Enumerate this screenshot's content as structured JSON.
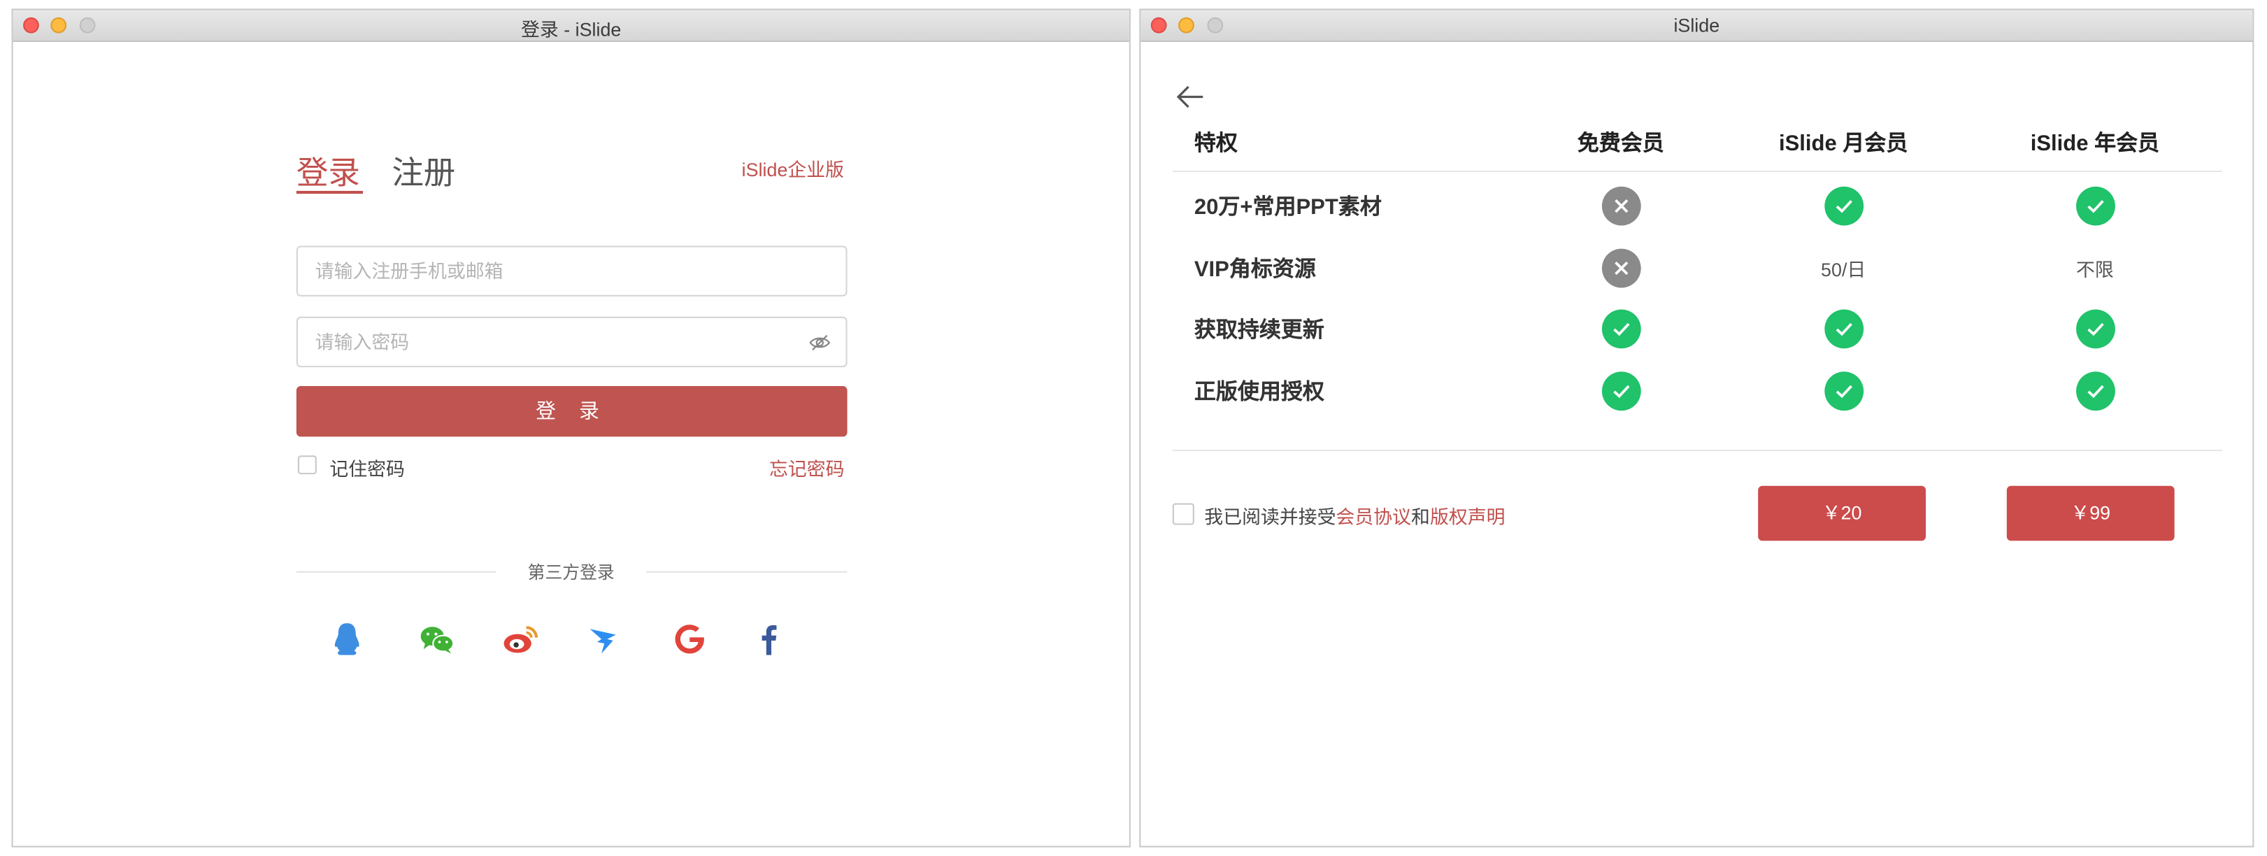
{
  "login_window": {
    "title": "登录 - iSlide",
    "tabs": {
      "login": "登录",
      "register": "注册"
    },
    "enterprise_link": "iSlide企业版",
    "account_input": {
      "placeholder": "请输入注册手机或邮箱",
      "value": ""
    },
    "password_input": {
      "placeholder": "请输入密码",
      "value": ""
    },
    "login_button": "登 录",
    "remember_label": "记住密码",
    "forgot_link": "忘记密码",
    "third_party_label": "第三方登录",
    "social_icons": [
      "qq-icon",
      "wechat-icon",
      "weibo-icon",
      "dingtalk-icon",
      "google-icon",
      "facebook-icon"
    ]
  },
  "membership_window": {
    "title": "iSlide",
    "headers": {
      "feature": "特权",
      "free": "免费会员",
      "monthly": "iSlide 月会员",
      "yearly": "iSlide 年会员"
    },
    "rows": [
      {
        "feature": "20万+常用PPT素材",
        "free": "x-icon",
        "monthly": "check-icon",
        "yearly": "check-icon"
      },
      {
        "feature": "VIP角标资源",
        "free": "x-icon",
        "monthly": "50/日",
        "yearly": "不限"
      },
      {
        "feature": "获取持续更新",
        "free": "check-icon",
        "monthly": "check-icon",
        "yearly": "check-icon"
      },
      {
        "feature": "正版使用授权",
        "free": "check-icon",
        "monthly": "check-icon",
        "yearly": "check-icon"
      }
    ],
    "agree": {
      "prefix": "我已阅读并接受",
      "link1": "会员协议",
      "and": "和",
      "link2": "版权声明"
    },
    "prices": {
      "monthly": "￥20",
      "yearly": "￥99"
    }
  },
  "colors": {
    "accent": "#c0504d",
    "check": "#20c26a",
    "cross": "#8a8a8a"
  }
}
